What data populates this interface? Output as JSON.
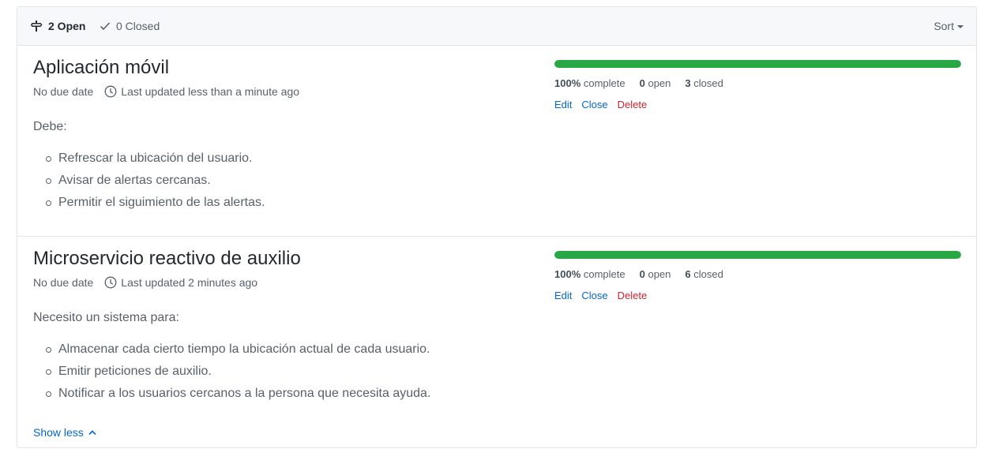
{
  "header": {
    "open_count_label": "2 Open",
    "closed_count_label": "0 Closed",
    "sort_label": "Sort"
  },
  "milestones": [
    {
      "title": "Aplicación móvil",
      "due": "No due date",
      "updated": "Last updated less than a minute ago",
      "intro": "Debe:",
      "items": [
        "Refrescar la ubicación del usuario.",
        "Avisar de alertas cercanas.",
        "Permitir el siguimiento de las alertas."
      ],
      "progress_fraction": 1.0,
      "percent": "100%",
      "complete_label": "complete",
      "open_count": "0",
      "open_label": "open",
      "closed_count": "3",
      "closed_label": "closed",
      "edit_label": "Edit",
      "close_label": "Close",
      "delete_label": "Delete"
    },
    {
      "title": "Microservicio reactivo de auxilio",
      "due": "No due date",
      "updated": "Last updated 2 minutes ago",
      "intro": "Necesito un sistema para:",
      "items": [
        "Almacenar cada cierto tiempo la ubicación actual de cada usuario.",
        "Emitir peticiones de auxilio.",
        "Notificar a los usuarios cercanos a la persona que necesita ayuda."
      ],
      "progress_fraction": 1.0,
      "percent": "100%",
      "complete_label": "complete",
      "open_count": "0",
      "open_label": "open",
      "closed_count": "6",
      "closed_label": "closed",
      "edit_label": "Edit",
      "close_label": "Close",
      "delete_label": "Delete",
      "show_less_label": "Show less"
    }
  ],
  "colors": {
    "progress": "#28a745",
    "link": "#0366d6",
    "danger": "#cb2431"
  },
  "icons": {
    "open": "milestone-icon",
    "closed": "check-icon",
    "updated": "clock-icon",
    "show_less": "chevron-up-icon"
  }
}
